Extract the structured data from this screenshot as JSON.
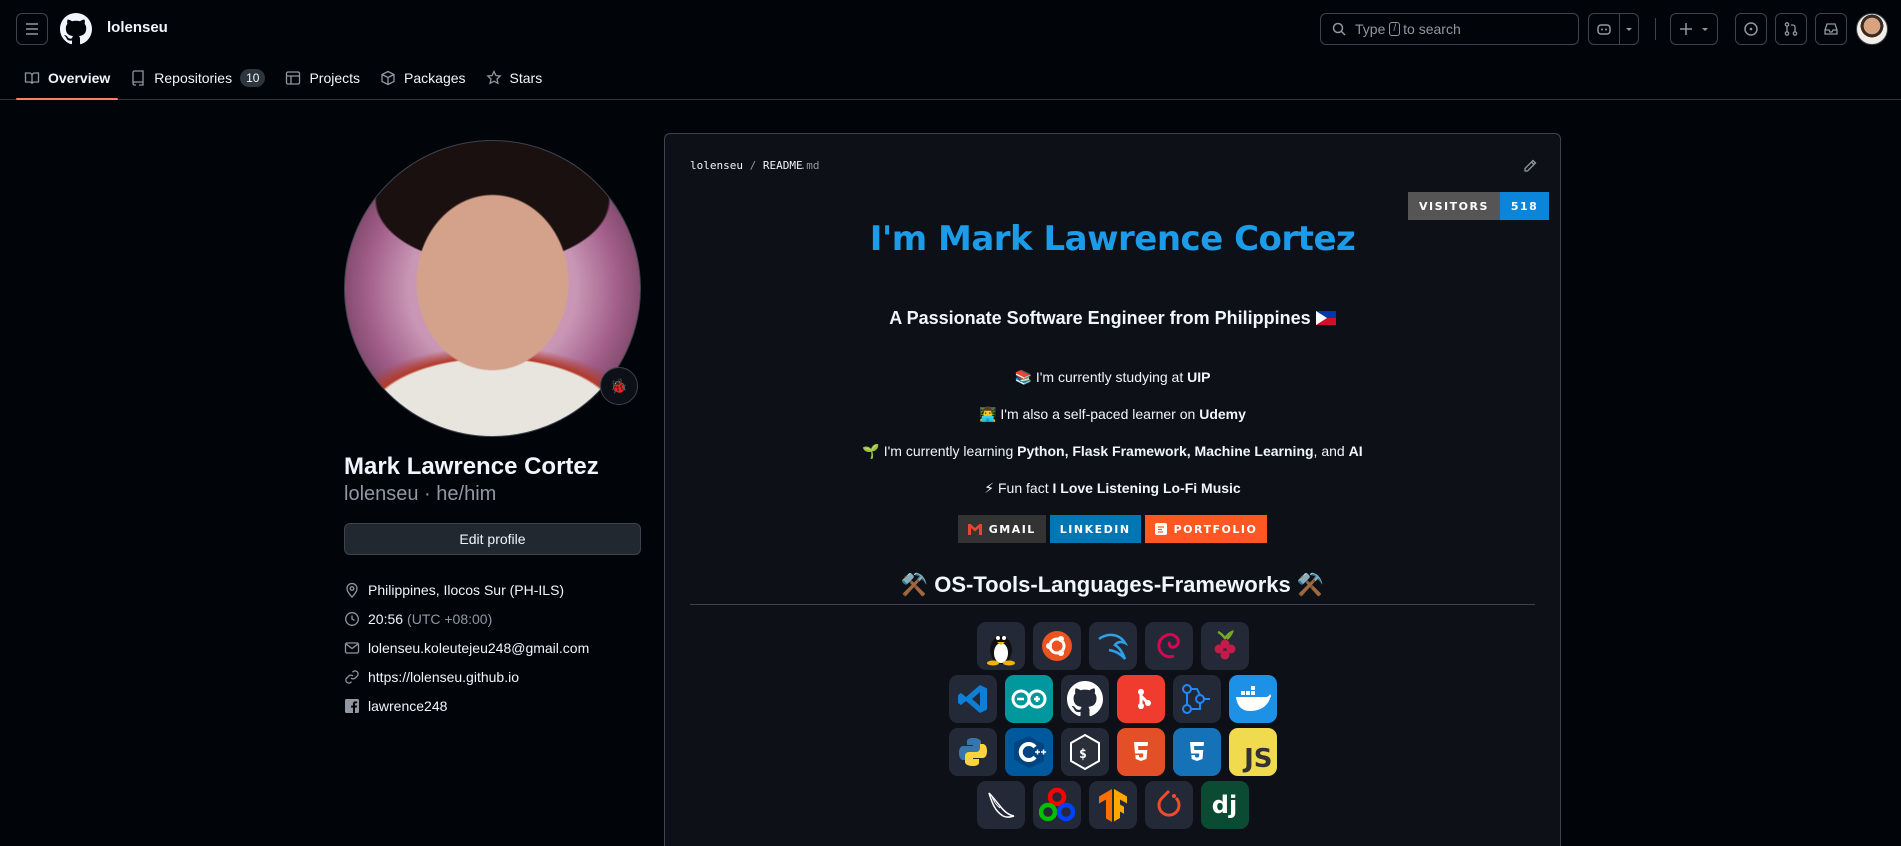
{
  "header": {
    "username": "lolenseu",
    "search_placeholder_prefix": "Type",
    "search_key": "/",
    "search_placeholder_suffix": "to search"
  },
  "tabs": [
    {
      "label": "Overview",
      "icon": "book-icon"
    },
    {
      "label": "Repositories",
      "icon": "repo-icon",
      "count": "10"
    },
    {
      "label": "Projects",
      "icon": "table-icon"
    },
    {
      "label": "Packages",
      "icon": "package-icon"
    },
    {
      "label": "Stars",
      "icon": "star-icon"
    }
  ],
  "profile": {
    "full_name": "Mark Lawrence Cortez",
    "handle": "lolenseu · he/him",
    "edit_label": "Edit profile",
    "location": "Philippines, Ilocos Sur (PH-ILS)",
    "time": "20:56",
    "timezone": "(UTC +08:00)",
    "email": "lolenseu.koleutejeu248@gmail.com",
    "website": "https://lolenseu.github.io",
    "facebook": "lawrence248"
  },
  "readme": {
    "path_user": "lolenseu",
    "path_sep": "/",
    "path_file": "README",
    "path_ext": ".md",
    "visitors_label": "VISITORS",
    "visitors_count": "518",
    "heading": "I'm Mark Lawrence Cortez",
    "tagline": "A Passionate Software Engineer from Philippines",
    "study_prefix": "📚 I'm currently studying at ",
    "study_school": "UIP",
    "learner_prefix": "👨‍💻 I'm also a self-paced learner on ",
    "learner_site": "Udemy",
    "learning_prefix": "🌱 I'm currently learning ",
    "learning_items": "Python, Flask Framework, Machine Learning",
    "learning_and": ", and ",
    "learning_last": "AI",
    "fun_prefix": "⚡ Fun fact ",
    "fun_fact": "I Love Listening Lo-Fi Music",
    "badges": [
      {
        "label": "GMAIL",
        "color": "#333333"
      },
      {
        "label": "LINKEDIN",
        "color": "#0077b5"
      },
      {
        "label": "PORTFOLIO",
        "color": "#ff5722"
      }
    ],
    "section_title": "⚒️ OS-Tools-Languages-Frameworks ⚒️"
  },
  "tech_icons": [
    [
      "linux-icon",
      "ubuntu-icon",
      "kali-icon",
      "debian-icon",
      "raspberry-pi-icon"
    ],
    [
      "vscode-icon",
      "arduino-icon",
      "github-icon",
      "git-icon",
      "github-actions-icon",
      "docker-icon"
    ],
    [
      "python-icon",
      "cpp-icon",
      "bash-icon",
      "html5-icon",
      "css3-icon",
      "javascript-icon"
    ],
    [
      "flask-icon",
      "opencv-icon",
      "tensorflow-icon",
      "pytorch-icon",
      "django-icon"
    ]
  ],
  "colors": {
    "accent": "#1c9be8",
    "tab_underline": "#f78166",
    "background": "#010409"
  }
}
